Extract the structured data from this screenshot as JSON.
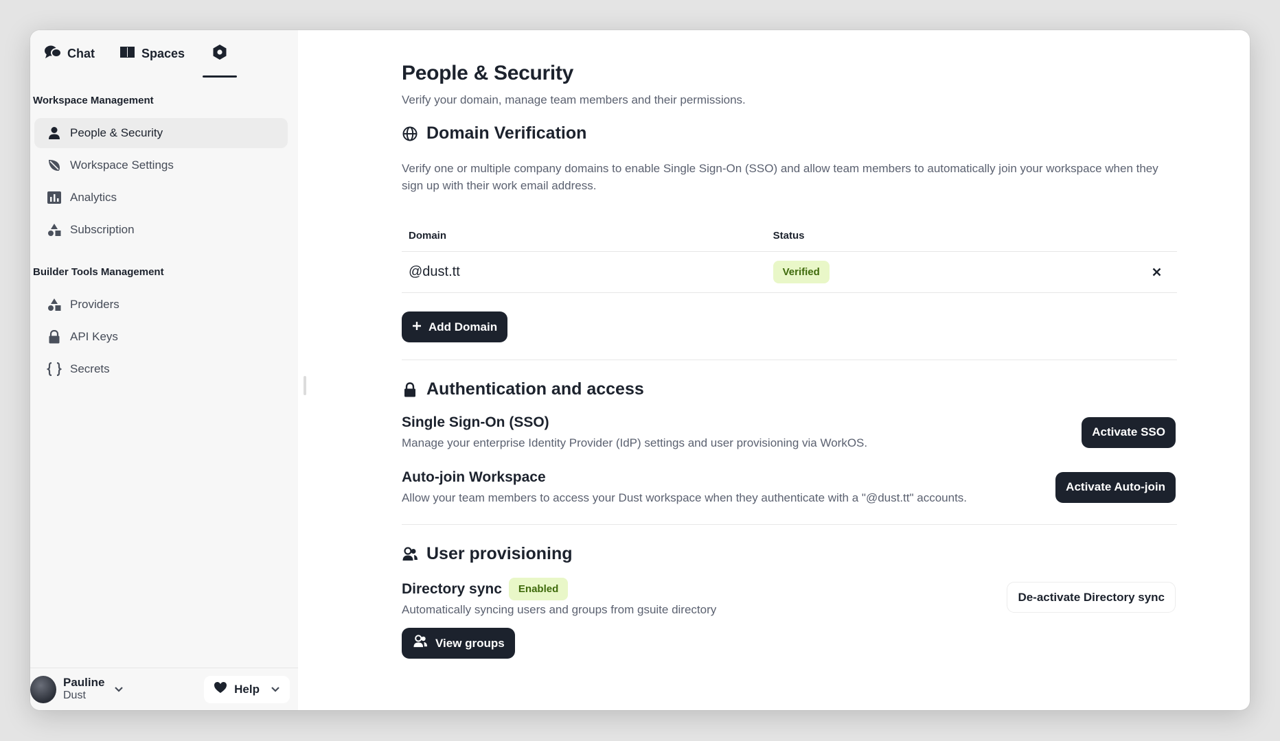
{
  "nav": {
    "chat_label": "Chat",
    "spaces_label": "Spaces",
    "admin_icon": "hexagon-settings-icon"
  },
  "sidebar": {
    "section1_title": "Workspace Management",
    "section1_items": [
      {
        "label": "People & Security",
        "icon": "user-icon",
        "active": true
      },
      {
        "label": "Workspace Settings",
        "icon": "leaf-icon"
      },
      {
        "label": "Analytics",
        "icon": "bar-chart-icon"
      },
      {
        "label": "Subscription",
        "icon": "shapes-icon"
      }
    ],
    "section2_title": "Builder Tools Management",
    "section2_items": [
      {
        "label": "Providers",
        "icon": "shapes-icon"
      },
      {
        "label": "API Keys",
        "icon": "lock-icon"
      },
      {
        "label": "Secrets",
        "icon": "braces-icon"
      }
    ]
  },
  "user": {
    "name": "Pauline",
    "org": "Dust"
  },
  "help_label": "Help",
  "page": {
    "title": "People & Security",
    "subtitle": "Verify your domain, manage team members and their permissions."
  },
  "domain_section": {
    "title": "Domain Verification",
    "description": "Verify one or multiple company domains to enable Single Sign-On (SSO) and allow team members to automatically join your workspace when they sign up with their work email address.",
    "columns": [
      "Domain",
      "Status"
    ],
    "rows": [
      {
        "domain": "@dust.tt",
        "status": "Verified"
      }
    ],
    "add_button": "Add Domain"
  },
  "auth_section": {
    "title": "Authentication and access",
    "sso": {
      "title": "Single Sign-On (SSO)",
      "description": "Manage your enterprise Identity Provider (IdP) settings and user provisioning via WorkOS.",
      "button": "Activate SSO"
    },
    "autojoin": {
      "title": "Auto-join Workspace",
      "description": "Allow your team members to access your Dust workspace when they authenticate with a \"@dust.tt\" accounts.",
      "button": "Activate Auto-join"
    }
  },
  "provisioning_section": {
    "title": "User provisioning",
    "directory": {
      "title": "Directory sync",
      "badge": "Enabled",
      "description": "Automatically syncing users and groups from gsuite directory",
      "deactivate_button": "De-activate Directory sync",
      "view_button": "View groups"
    }
  },
  "colors": {
    "dark": "#1c222d",
    "muted_text": "#5b6170",
    "badge_bg": "#e9f7c8",
    "badge_text": "#3f6a0c",
    "sidebar_bg": "#f7f7f7"
  }
}
